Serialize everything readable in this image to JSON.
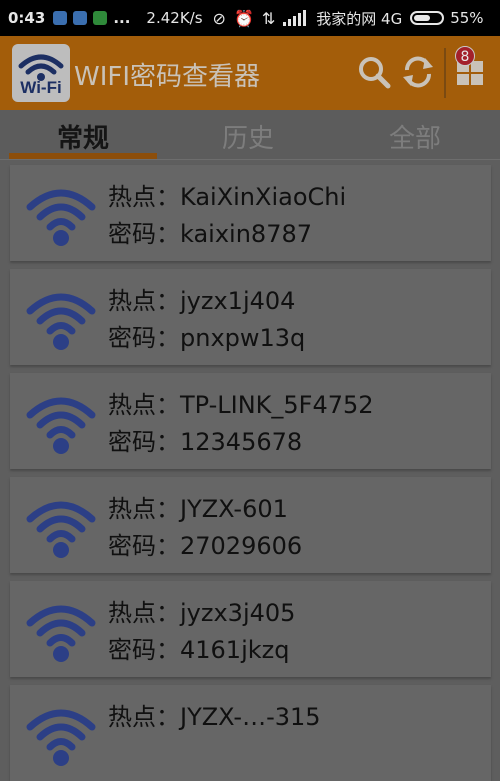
{
  "status_bar": {
    "time": "0:43",
    "dots": "...",
    "speed": "2.42K/s",
    "carrier": "我家的网 4G",
    "battery": "55%"
  },
  "app_bar": {
    "logo_text": "Wi-Fi",
    "title": "WIFI密码查看器",
    "badge_count": "8",
    "actions": [
      "search-icon",
      "refresh-icon",
      "apps-grid-icon"
    ]
  },
  "tabs": [
    {
      "label": "常规",
      "active": true
    },
    {
      "label": "历史",
      "active": false
    },
    {
      "label": "全部",
      "active": false
    }
  ],
  "networks": [
    {
      "line1": "热点：KaiXinXiaoChi",
      "line2": "密码：kaixin8787"
    },
    {
      "line1": "热点：jyzx1j404",
      "line2": "密码：pnxpw13q"
    },
    {
      "line1": "热点：TP-LINK_5F4752",
      "line2": "密码：12345678"
    },
    {
      "line1": "热点：JYZX-601",
      "line2": "密码：27029606"
    },
    {
      "line1": "热点：jyzx3j405",
      "line2": "密码：4161jkzq"
    },
    {
      "line1": "热点：JYZX-…-315",
      "line2": ""
    }
  ],
  "colors": {
    "app_bar": "#a35d0a",
    "tab_indicator": "#8c4e0b",
    "wifi_icon": "#2c3f86"
  }
}
